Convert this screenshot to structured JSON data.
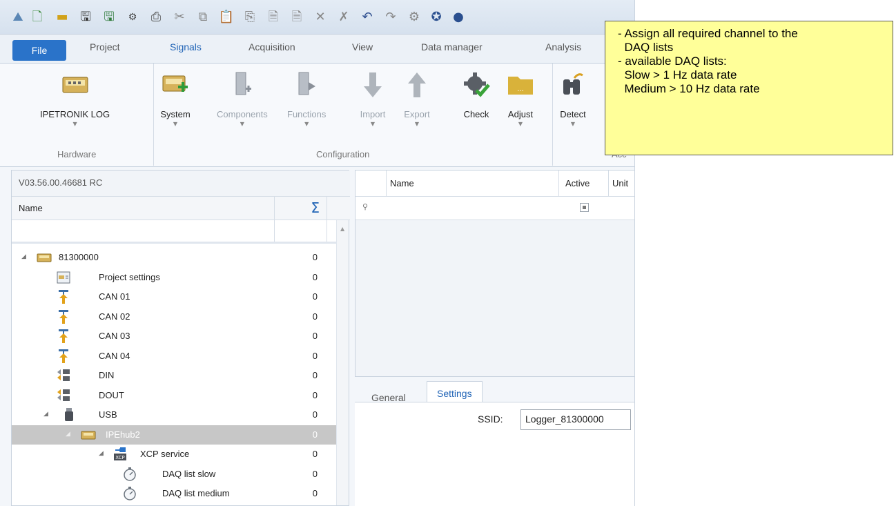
{
  "menu": {
    "file": "File",
    "tabs": [
      "Project",
      "Signals",
      "Acquisition",
      "View",
      "Data manager",
      "Analysis"
    ]
  },
  "ribbon": {
    "hardware": {
      "button": "IPETRONIK LOG",
      "group": "Hardware"
    },
    "configuration": {
      "group": "Configuration",
      "buttons": [
        "System",
        "Components",
        "Functions",
        "Import",
        "Export",
        "Check",
        "Adjust"
      ]
    },
    "detect": "Detect",
    "partial_group": "Acc"
  },
  "version": "V03.56.00.46681 RC",
  "tree": {
    "col_name": "Name",
    "col_sum": "Σ",
    "rows": [
      {
        "label": "81300000",
        "value": "0"
      },
      {
        "label": "Project settings",
        "value": "0"
      },
      {
        "label": "CAN 01",
        "value": "0"
      },
      {
        "label": "CAN 02",
        "value": "0"
      },
      {
        "label": "CAN 03",
        "value": "0"
      },
      {
        "label": "CAN 04",
        "value": "0"
      },
      {
        "label": "DIN",
        "value": "0"
      },
      {
        "label": "DOUT",
        "value": "0"
      },
      {
        "label": "USB",
        "value": "0"
      },
      {
        "label": "IPEhub2",
        "value": "0"
      },
      {
        "label": "XCP service",
        "value": "0"
      },
      {
        "label": "DAQ list slow",
        "value": "0"
      },
      {
        "label": "DAQ list medium",
        "value": "0"
      }
    ]
  },
  "grid": {
    "columns": [
      "Name",
      "Active",
      "Unit"
    ]
  },
  "settings": {
    "tabs": [
      "General",
      "Settings"
    ],
    "ssid_label": "SSID:",
    "ssid_value": "Logger_81300000"
  },
  "note": {
    "lines": [
      "- Assign all required channel to the",
      "  DAQ lists",
      "- available DAQ lists:",
      "  Slow > 1 Hz data rate",
      "  Medium > 10 Hz data rate"
    ]
  },
  "colors": {
    "accent": "#1f63b6",
    "file_tab": "#2a73c9",
    "note_bg": "#ffff99",
    "selected_row": "#c7c7c7"
  }
}
